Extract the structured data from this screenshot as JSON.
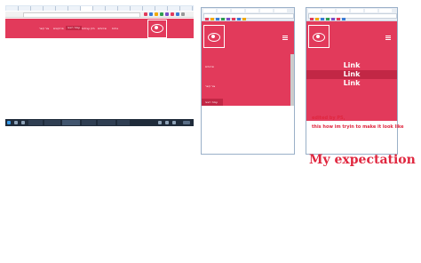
{
  "colors": {
    "brand_red": "#e23a5b",
    "brand_red_dark": "#c22745",
    "annotation_red": "#e0273f"
  },
  "desktop": {
    "nav_links": [
      "צור קשר",
      "פרויקטים",
      "אודות",
      "עמוד ראשי",
      "תיק עבודות",
      "שירותים"
    ]
  },
  "mobile_current": {
    "menu_items": [
      "שירותים",
      "צור קשר",
      "עמוד ראשי"
    ]
  },
  "expectation": {
    "links": [
      "Link",
      "Link",
      "Link"
    ],
    "note_line1": "edited by PS,",
    "note_line2": "this how im tryin to make it look like",
    "title": "My expectation"
  }
}
